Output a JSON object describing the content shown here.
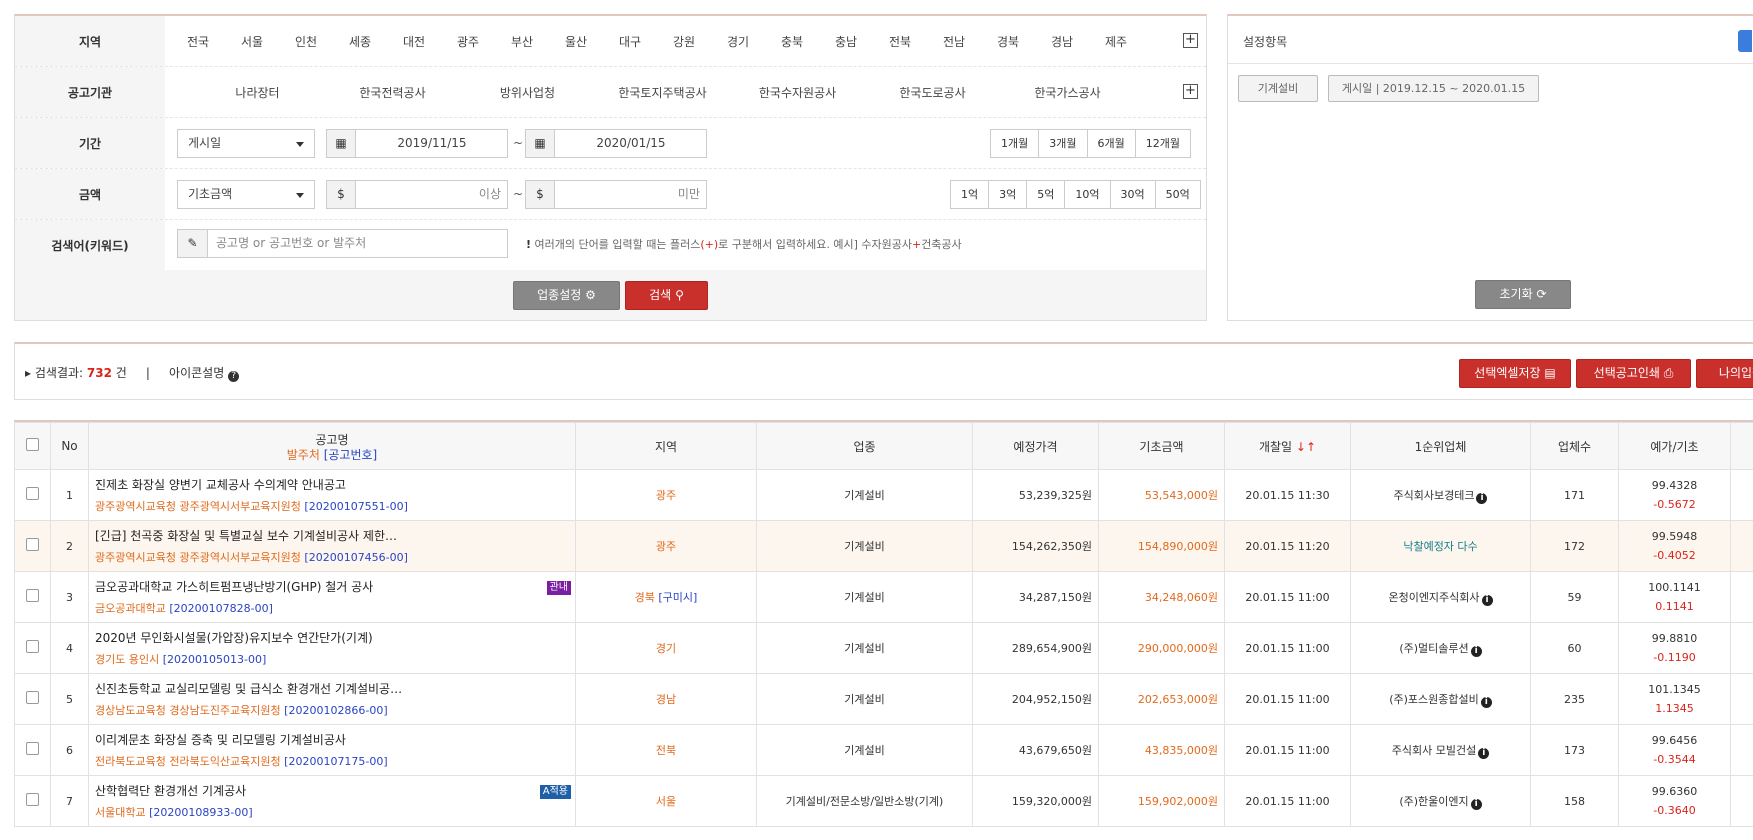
{
  "search": {
    "region_label": "지역",
    "regions": [
      "전국",
      "서울",
      "인천",
      "세종",
      "대전",
      "광주",
      "부산",
      "울산",
      "대구",
      "강원",
      "경기",
      "충북",
      "충남",
      "전북",
      "전남",
      "경북",
      "경남",
      "제주"
    ],
    "agency_label": "공고기관",
    "agencies": [
      "나라장터",
      "한국전력공사",
      "방위사업청",
      "한국토지주택공사",
      "한국수자원공사",
      "한국도로공사",
      "한국가스공사"
    ],
    "period_label": "기간",
    "period_select": "게시일",
    "date_from": "2019/11/15",
    "date_to": "2020/01/15",
    "period_buttons": [
      "1개월",
      "3개월",
      "6개월",
      "12개월"
    ],
    "amount_label": "금액",
    "amount_select": "기초금액",
    "amount_from_suffix": "이상",
    "amount_to_suffix": "미만",
    "currency_symbol": "$",
    "tilde": "~",
    "amount_buttons": [
      "1억",
      "3억",
      "5억",
      "10억",
      "30억",
      "50억"
    ],
    "keyword_label": "검색어(키워드)",
    "keyword_placeholder": "공고명 or 공고번호 or 발주처",
    "hint_mark": "!",
    "hint_text": "여러개의 단어를 입력할 때는 플러스",
    "hint_plus": "(+)",
    "hint_text2": "로 구분해서 입력하세요. 예시] 수자원공사",
    "hint_plus2": "+",
    "hint_text3": "건축공사",
    "industry_button": "업종설정",
    "search_button": "검색"
  },
  "settings": {
    "title": "설정항목",
    "chip_industry": "기계설비",
    "chip_period": "게시일 | 2019.12.15 ~ 2020.01.15",
    "reset_button": "초기화"
  },
  "results": {
    "label": "검색결과:",
    "count": "732",
    "unit": "건",
    "separator": "|",
    "icon_help": "아이콘설명",
    "btn_excel": "선택엑셀저장",
    "btn_print": "선택공고인쇄",
    "btn_mine": "나의입찰"
  },
  "table": {
    "headers": {
      "no": "No",
      "title": "공고명",
      "title_sub1": "발주처",
      "title_sub2": "[공고번호]",
      "region": "지역",
      "industry": "업종",
      "est_price": "예정가격",
      "base_amount": "기초금액",
      "open_date": "개찰일",
      "first_company": "1순위업체",
      "companies": "업체수",
      "ratio": "예가/기초"
    },
    "rows": [
      {
        "no": "1",
        "title": "진제초 화장실 양변기 교체공사 수의계약 안내공고",
        "org": "광주광역시교육청 광주광역시서부교육지원청",
        "num": "[20200107551-00]",
        "badge": "",
        "region": "광주",
        "region2": "",
        "industry": "기계설비",
        "est": "53,239,325원",
        "base": "53,543,000원",
        "date": "20.01.15 11:30",
        "company": "주식회사보경테크",
        "companies": "171",
        "r1": "99.4328",
        "r2": "-0.5672"
      },
      {
        "no": "2",
        "title": "[긴급] 천곡중 화장실 및 특별교실 보수 기계설비공사 제한…",
        "org": "광주광역시교육청 광주광역시서부교육지원청",
        "num": "[20200107456-00]",
        "badge": "",
        "region": "광주",
        "region2": "",
        "industry": "기계설비",
        "est": "154,262,350원",
        "base": "154,890,000원",
        "date": "20.01.15 11:20",
        "company": "낙찰예정자 다수",
        "companies": "172",
        "r1": "99.5948",
        "r2": "-0.4052"
      },
      {
        "no": "3",
        "title": "금오공과대학교 가스히트펌프냉난방기(GHP) 철거 공사",
        "org": "금오공과대학교",
        "num": "[20200107828-00]",
        "badge": "관내",
        "region": "경북",
        "region2": "[구미시]",
        "industry": "기계설비",
        "est": "34,287,150원",
        "base": "34,248,060원",
        "date": "20.01.15 11:00",
        "company": "온청이엔지주식회사",
        "companies": "59",
        "r1": "100.1141",
        "r2": "0.1141"
      },
      {
        "no": "4",
        "title": "2020년 무인화시설물(가압장)유지보수 연간단가(기계)",
        "org": "경기도 용인시",
        "num": "[20200105013-00]",
        "badge": "",
        "region": "경기",
        "region2": "",
        "industry": "기계설비",
        "est": "289,654,900원",
        "base": "290,000,000원",
        "date": "20.01.15 11:00",
        "company": "(주)멀티솔루션",
        "companies": "60",
        "r1": "99.8810",
        "r2": "-0.1190"
      },
      {
        "no": "5",
        "title": "신진초등학교 교실리모델링 및 급식소 환경개선 기계설비공…",
        "org": "경상남도교육청 경상남도진주교육지원청",
        "num": "[20200102866-00]",
        "badge": "",
        "region": "경남",
        "region2": "",
        "industry": "기계설비",
        "est": "204,952,150원",
        "base": "202,653,000원",
        "date": "20.01.15 11:00",
        "company": "(주)포스원종합설비",
        "companies": "235",
        "r1": "101.1345",
        "r2": "1.1345"
      },
      {
        "no": "6",
        "title": "이리계문초 화장실 증축 및 리모델링 기계설비공사",
        "org": "전라북도교육청 전라북도익산교육지원청",
        "num": "[20200107175-00]",
        "badge": "",
        "region": "전북",
        "region2": "",
        "industry": "기계설비",
        "est": "43,679,650원",
        "base": "43,835,000원",
        "date": "20.01.15 11:00",
        "company": "주식회사 모빌건설",
        "companies": "173",
        "r1": "99.6456",
        "r2": "-0.3544"
      },
      {
        "no": "7",
        "title": "산학협력단 환경개선 기계공사",
        "org": "서울대학교",
        "num": "[20200108933-00]",
        "badge": "A적용",
        "region": "서울",
        "region2": "",
        "industry": "기계설비/전문소방/일반소방(기계)",
        "est": "159,320,000원",
        "base": "159,902,000원",
        "date": "20.01.15 11:00",
        "company": "(주)한울이엔지",
        "companies": "158",
        "r1": "99.6360",
        "r2": "-0.3640"
      }
    ]
  },
  "colors": {
    "accent_red": "#c9302c",
    "org_orange": "#e06a1c",
    "num_blue": "#2a44c5",
    "teal": "#167d8a",
    "badge_purple": "#7a1fa2",
    "badge_blue": "#1f5fa8"
  }
}
